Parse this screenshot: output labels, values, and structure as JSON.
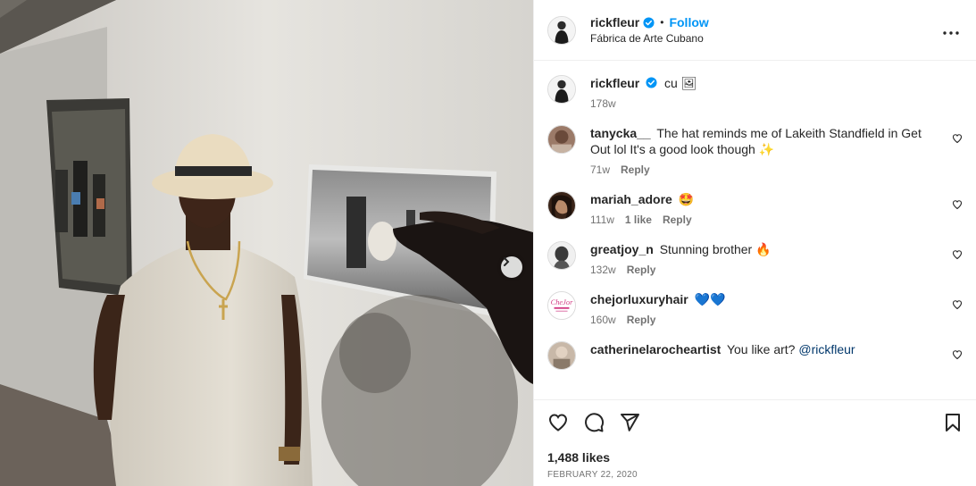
{
  "post": {
    "author": {
      "username": "rickfleur",
      "verified": true,
      "follow_label": "Follow",
      "separator": "•",
      "location": "Fábrica de Arte Cubano"
    },
    "more_options_icon": "more-horizontal-icon",
    "carousel_next_icon": "chevron-right-icon"
  },
  "caption": {
    "username": "rickfleur",
    "text": "cu 🖼",
    "age": "178w"
  },
  "comments": [
    {
      "username": "tanycka__",
      "text": "The hat reminds me of Lakeith Standfield in Get Out lol It's a good look though ✨",
      "age": "71w",
      "likes": "",
      "reply": "Reply"
    },
    {
      "username": "mariah_adore",
      "text": "🤩",
      "age": "111w",
      "likes": "1 like",
      "reply": "Reply"
    },
    {
      "username": "greatjoy_n",
      "text": "Stunning brother 🔥",
      "age": "132w",
      "likes": "",
      "reply": "Reply"
    },
    {
      "username": "chejorluxuryhair",
      "text": "💙💙",
      "age": "160w",
      "likes": "",
      "reply": "Reply"
    },
    {
      "username": "catherinelarocheartist",
      "text": "You like art? ",
      "mention": "@rickfleur",
      "age": "",
      "likes": "",
      "reply": ""
    }
  ],
  "actions": {
    "like_icon": "heart-icon",
    "comment_icon": "comment-icon",
    "share_icon": "send-icon",
    "save_icon": "bookmark-icon"
  },
  "likes_text": "1,488 likes",
  "date_text": "FEBRUARY 22, 2020",
  "colors": {
    "accent": "#0095f6",
    "verified_badge": "#0095f6",
    "text_primary": "#262626",
    "text_secondary": "#737373",
    "divider": "#efefef"
  }
}
